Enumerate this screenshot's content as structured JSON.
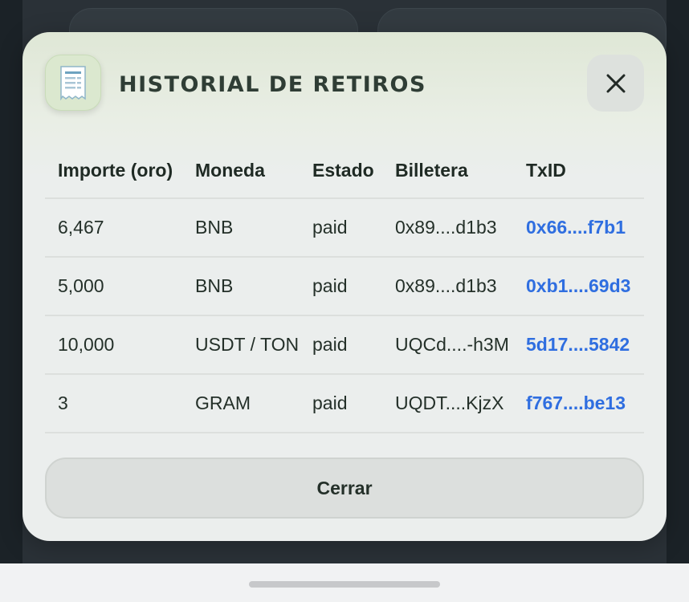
{
  "modal": {
    "title": "HISTORIAL DE RETIROS",
    "icon": "receipt-icon",
    "close_icon": "close-icon",
    "close_button_label": "Cerrar"
  },
  "table": {
    "headers": [
      "Importe (oro)",
      "Moneda",
      "Estado",
      "Billetera",
      "TxID"
    ],
    "rows": [
      {
        "amount": "6,467",
        "currency": "BNB",
        "status": "paid",
        "wallet": "0x89....d1b3",
        "txid": "0x66....f7b1"
      },
      {
        "amount": "5,000",
        "currency": "BNB",
        "status": "paid",
        "wallet": "0x89....d1b3",
        "txid": "0xb1....69d3"
      },
      {
        "amount": "10,000",
        "currency": "USDT / TON",
        "status": "paid",
        "wallet": "UQCd....-h3M",
        "txid": "5d17....5842"
      },
      {
        "amount": "3",
        "currency": "GRAM",
        "status": "paid",
        "wallet": "UQDT....KjzX",
        "txid": "f767....be13"
      }
    ]
  },
  "colors": {
    "txid_link": "#2f6ee0",
    "modal_bg": "#ebeeed",
    "title": "#2f3d35"
  }
}
